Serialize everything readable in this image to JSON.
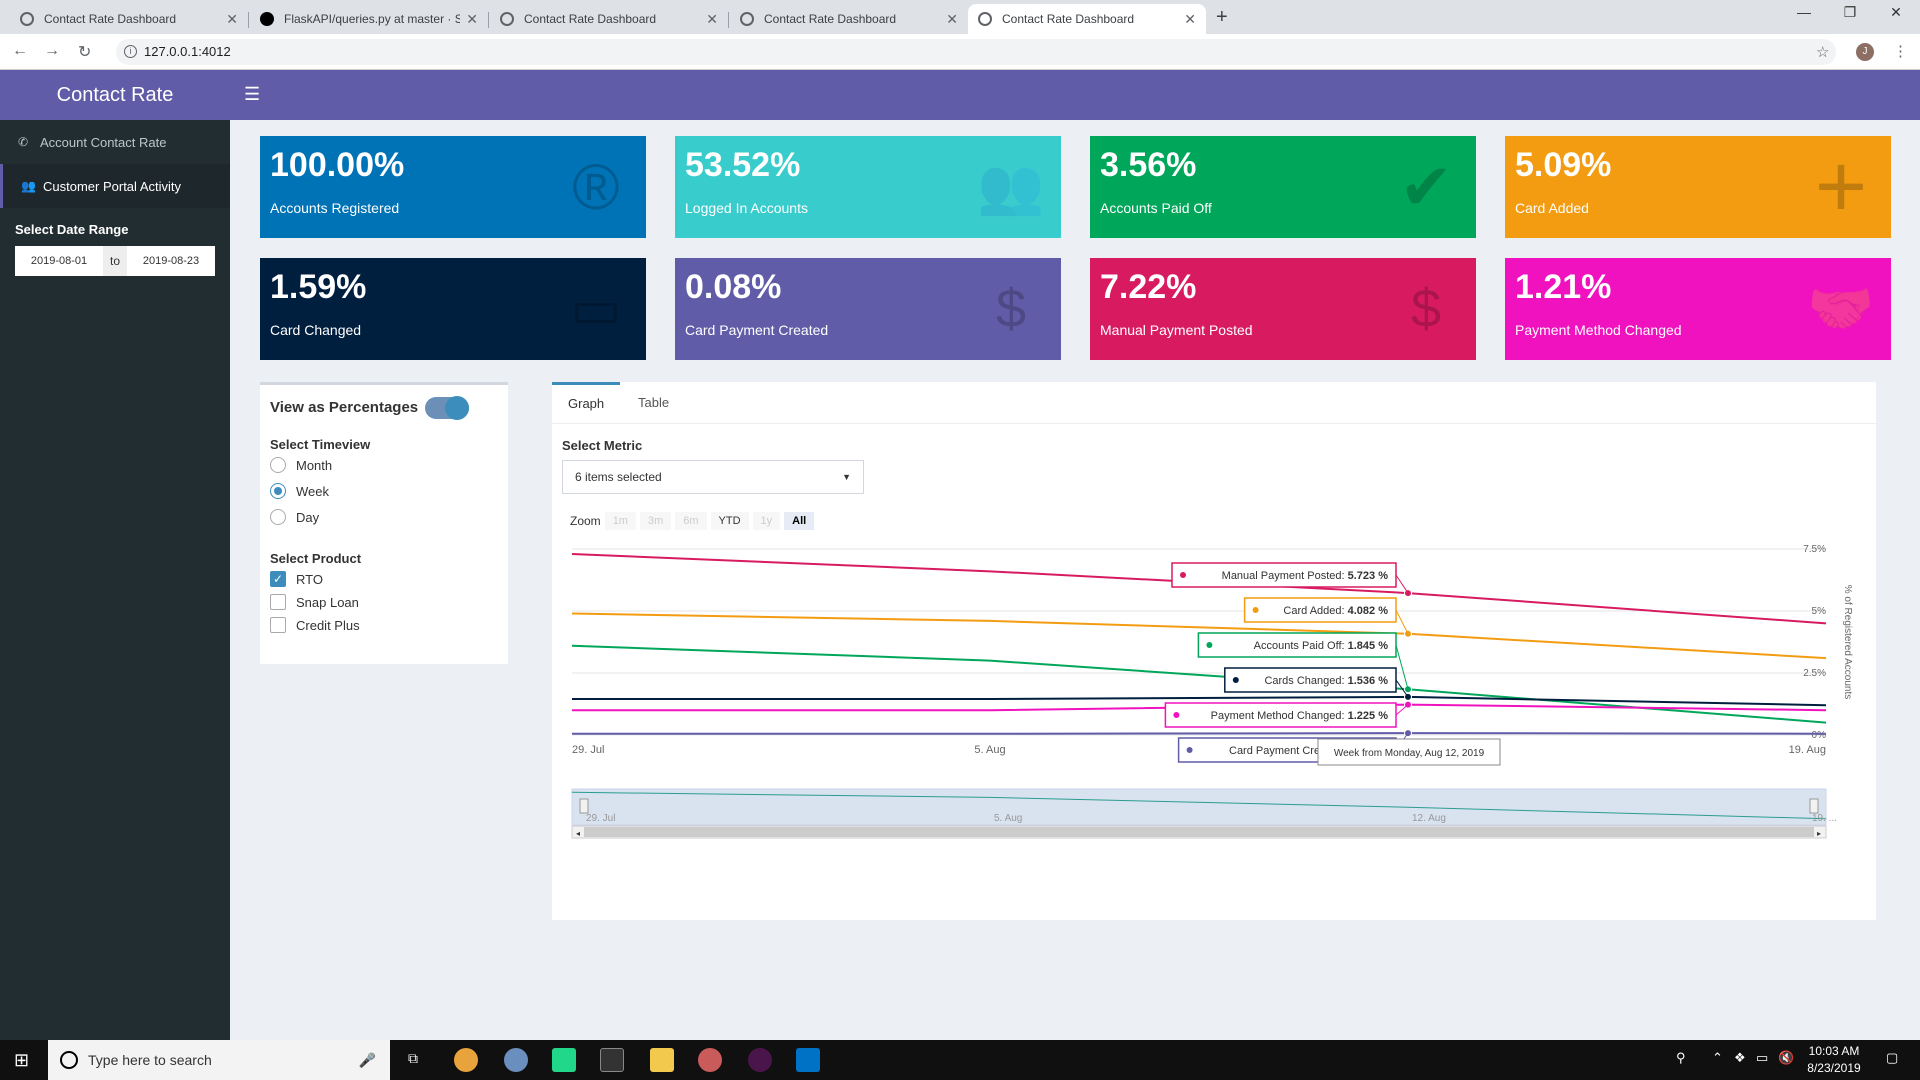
{
  "browser": {
    "tabs": [
      "Contact Rate Dashboard",
      "FlaskAPI/queries.py at master · S:",
      "Contact Rate Dashboard",
      "Contact Rate Dashboard",
      "Contact Rate Dashboard"
    ],
    "url": "127.0.0.1:4012",
    "profile_initial": "J"
  },
  "sidebar": {
    "brand": "Contact Rate",
    "items": [
      {
        "label": "Account Contact Rate",
        "icon": "phone-icon"
      },
      {
        "label": "Customer Portal Activity",
        "icon": "users-icon"
      }
    ],
    "date_label": "Select Date Range",
    "date_from": "2019-08-01",
    "date_sep": "to",
    "date_to": "2019-08-23"
  },
  "boxes": [
    {
      "value": "100.00%",
      "label": "Accounts Registered",
      "color": "#0073b7",
      "icon": "registered-icon"
    },
    {
      "value": "53.52%",
      "label": "Logged In Accounts",
      "color": "#39cccc",
      "icon": "users-icon"
    },
    {
      "value": "3.56%",
      "label": "Accounts Paid Off",
      "color": "#00a65a",
      "icon": "user-check-icon"
    },
    {
      "value": "5.09%",
      "label": "Card Added",
      "color": "#f39c12",
      "icon": "plus-icon"
    },
    {
      "value": "1.59%",
      "label": "Card Changed",
      "color": "#001f3f",
      "icon": "credit-card-icon"
    },
    {
      "value": "0.08%",
      "label": "Card Payment Created",
      "color": "#605ca8",
      "icon": "money-bill-icon"
    },
    {
      "value": "7.22%",
      "label": "Manual Payment Posted",
      "color": "#d81b60",
      "icon": "file-invoice-dollar-icon"
    },
    {
      "value": "1.21%",
      "label": "Payment Method Changed",
      "color": "#f012be",
      "icon": "handshake-icon"
    }
  ],
  "controls": {
    "pct_label": "View as Percentages",
    "pct_on": true,
    "timeview_label": "Select Timeview",
    "timeview": [
      "Month",
      "Week",
      "Day"
    ],
    "timeview_selected": "Week",
    "product_label": "Select Product",
    "products": [
      {
        "label": "RTO",
        "checked": true
      },
      {
        "label": "Snap Loan",
        "checked": false
      },
      {
        "label": "Credit Plus",
        "checked": false
      }
    ]
  },
  "panel": {
    "tabs": [
      "Graph",
      "Table"
    ],
    "active_tab": "Graph",
    "metric_label": "Select Metric",
    "metric_value": "6 items selected",
    "zoom_label": "Zoom",
    "zoom_buttons": [
      "1m",
      "3m",
      "6m",
      "YTD",
      "1y",
      "All"
    ],
    "zoom_selected": "All",
    "zoom_enabled": [
      "YTD",
      "All"
    ]
  },
  "chart_data": {
    "type": "line",
    "ylabel": "% of Registered Accounts",
    "x": [
      "29. Jul",
      "5. Aug",
      "12. Aug",
      "19. Aug"
    ],
    "ylim": [
      0,
      7.5
    ],
    "yticks": [
      "0%",
      "2.5%",
      "5%",
      "7.5%"
    ],
    "series": [
      {
        "name": "Manual Payment Posted",
        "color": "#d81b60",
        "values": [
          7.3,
          6.6,
          5.723,
          4.5
        ]
      },
      {
        "name": "Card Added",
        "color": "#f39c12",
        "values": [
          4.9,
          4.6,
          4.082,
          3.1
        ]
      },
      {
        "name": "Accounts Paid Off",
        "color": "#00a65a",
        "values": [
          3.6,
          3.0,
          1.845,
          0.5
        ]
      },
      {
        "name": "Cards Changed",
        "color": "#001f3f",
        "values": [
          1.45,
          1.45,
          1.536,
          1.2
        ]
      },
      {
        "name": "Payment Method Changed",
        "color": "#f012be",
        "values": [
          1.0,
          1.0,
          1.225,
          1.0
        ]
      },
      {
        "name": "Card Payment Created",
        "color": "#605ca8",
        "values": [
          0.05,
          0.05,
          0.076,
          0.05
        ]
      }
    ],
    "tooltip_header": "Week from Monday, Aug 12, 2019",
    "navigator_labels": [
      "29. Jul",
      "5. Aug",
      "12. Aug",
      "19. ..."
    ]
  },
  "taskbar": {
    "search_placeholder": "Type here to search",
    "time": "10:03 AM",
    "date": "8/23/2019"
  }
}
